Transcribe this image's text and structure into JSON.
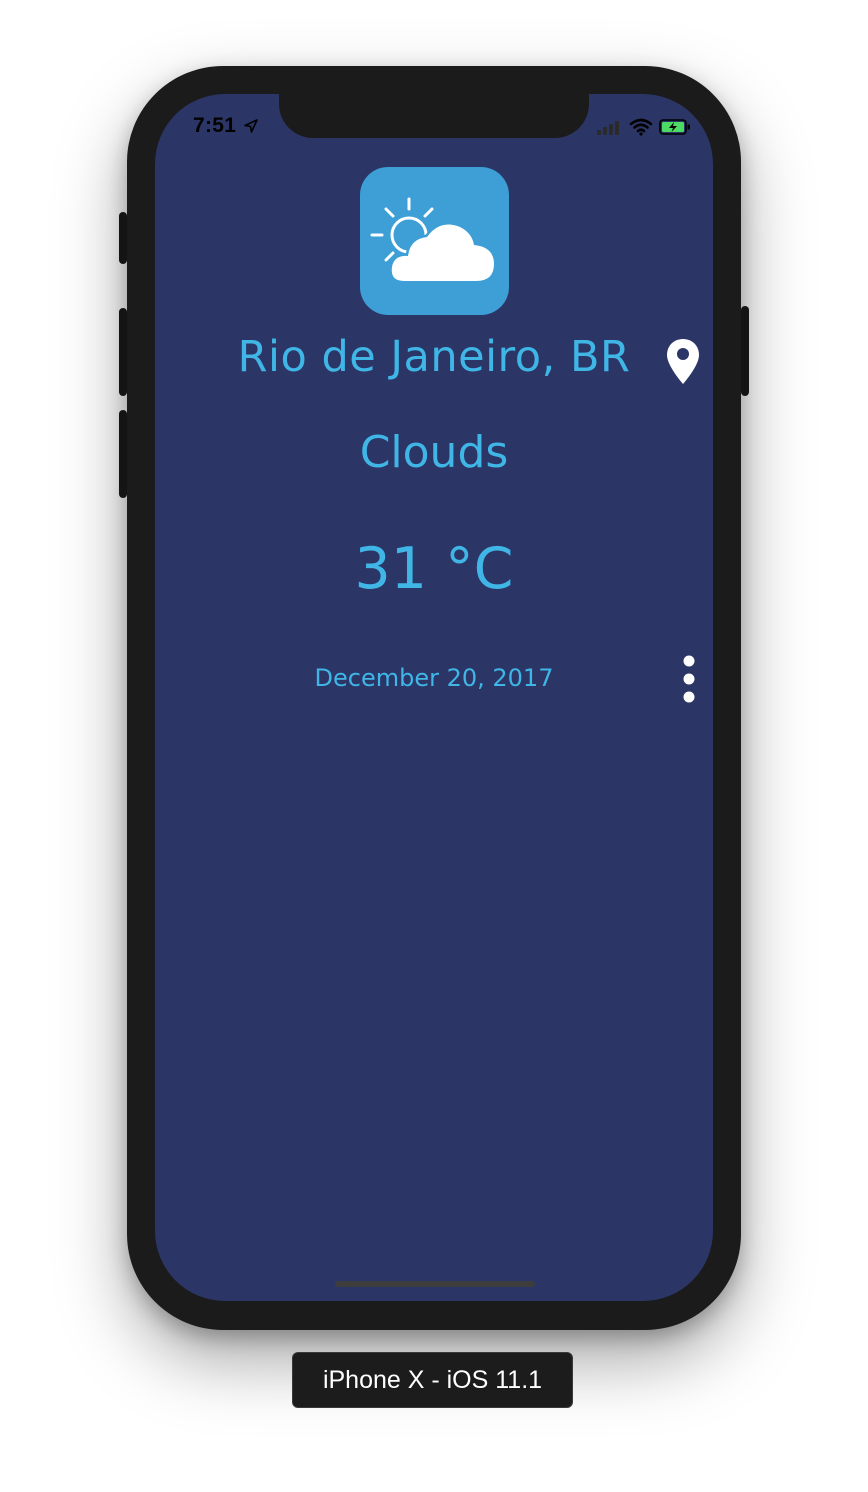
{
  "status_bar": {
    "time": "7:51",
    "location_arrow_icon": "location-arrow-icon",
    "signal_icon": "cellular-signal-icon",
    "wifi_icon": "wifi-icon",
    "battery_icon": "battery-charging-icon"
  },
  "weather": {
    "icon": "partly-cloudy-icon",
    "city": "Rio de Janeiro, BR",
    "condition": "Clouds",
    "temperature": "31 °C",
    "date": "December 20, 2017"
  },
  "actions": {
    "location_button_icon": "map-pin-icon",
    "more_button_icon": "more-vertical-icon"
  },
  "device_label": "iPhone X - iOS 11.1",
  "colors": {
    "background": "#2b3667",
    "accent_text": "#3fb6e6",
    "icon_tile": "#3d9fd6",
    "bezel": "#1b1b1b",
    "battery": "#4cd964"
  }
}
